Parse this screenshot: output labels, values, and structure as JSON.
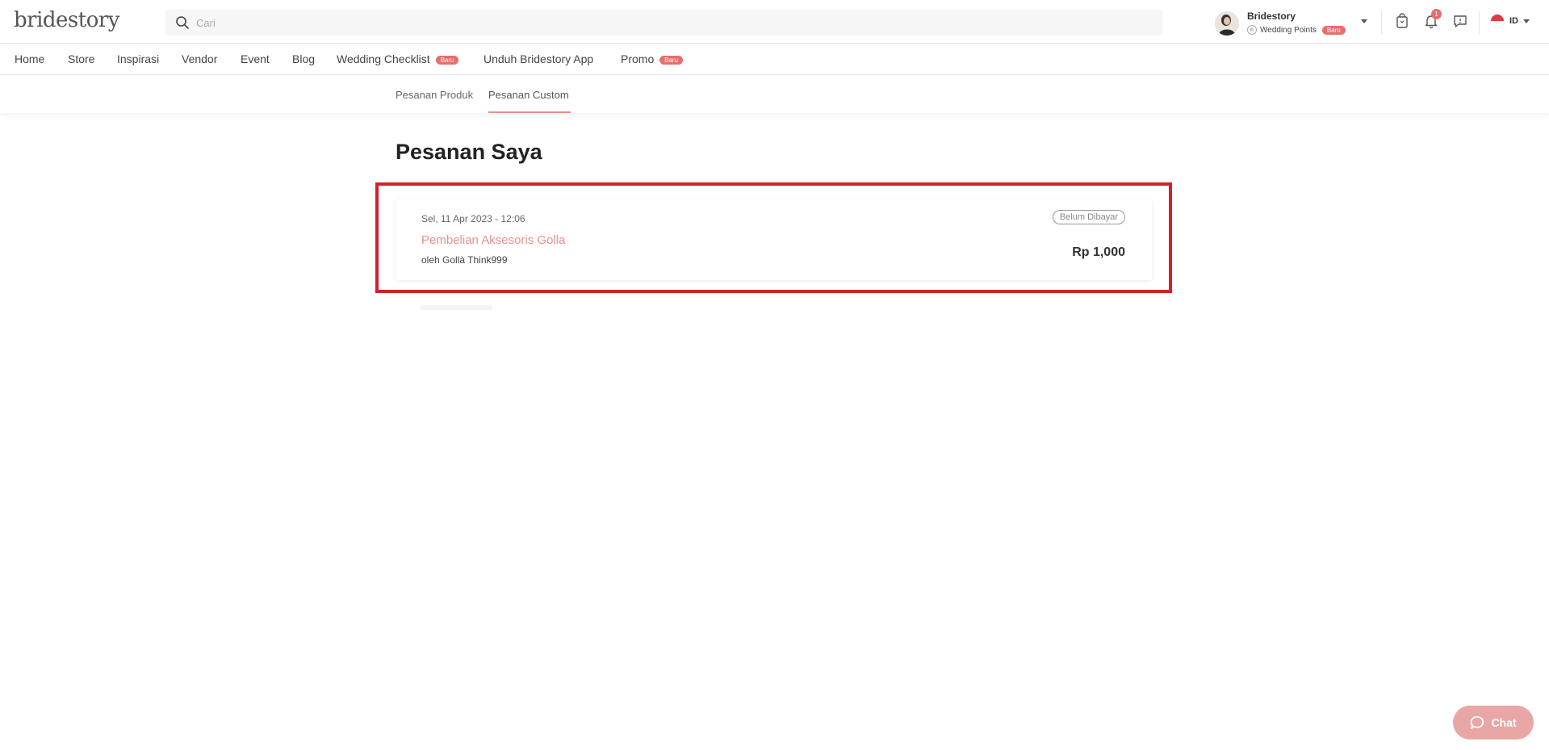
{
  "brand": {
    "logo_text": "bridestory"
  },
  "search": {
    "placeholder": "Cari",
    "value": ""
  },
  "user": {
    "name": "Bridestory",
    "points_label": "Wedding Points",
    "points_badge": "Baru"
  },
  "header_icons": {
    "cart": "shopping-bag-icon",
    "notifications": "bell-icon",
    "notification_count": "1",
    "messages": "chat-icon"
  },
  "language": {
    "code": "ID"
  },
  "nav": {
    "items": [
      {
        "label": "Home"
      },
      {
        "label": "Store"
      },
      {
        "label": "Inspirasi"
      },
      {
        "label": "Vendor"
      },
      {
        "label": "Event"
      },
      {
        "label": "Blog"
      },
      {
        "label": "Wedding Checklist",
        "badge": "Baru"
      },
      {
        "label": "Unduh Bridestory App"
      },
      {
        "label": "Promo",
        "badge": "Baru"
      }
    ]
  },
  "subtabs": [
    {
      "label": "Pesanan Produk"
    },
    {
      "label": "Pesanan Custom",
      "active": true
    }
  ],
  "page": {
    "title": "Pesanan Saya"
  },
  "orders": [
    {
      "date": "Sel, 11 Apr 2023 - 12:06",
      "title": "Pembelian Aksesoris Golla",
      "by": "oleh Gollà Think999",
      "status": "Belum Dibayar",
      "price": "Rp 1,000"
    }
  ],
  "chat": {
    "label": "Chat"
  },
  "colors": {
    "accent": "#e8918e",
    "badge": "#e66e6e",
    "highlight": "#d3202b",
    "chat_button": "#e8a7a5"
  }
}
